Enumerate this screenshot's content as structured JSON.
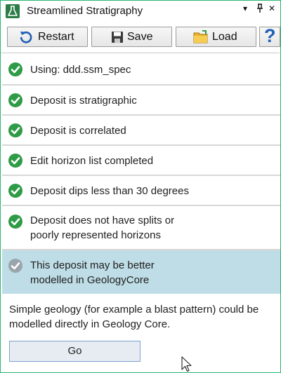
{
  "window": {
    "title": "Streamlined Stratigraphy",
    "controls": [
      "▾",
      "⊥",
      "✕"
    ],
    "border_color": "#2bb673"
  },
  "toolbar": {
    "restart_label": "Restart",
    "save_label": "Save",
    "load_label": "Load",
    "help_label": "?"
  },
  "steps": [
    {
      "text": "Using: ddd.ssm_spec",
      "status": "done"
    },
    {
      "text": "Deposit is stratigraphic",
      "status": "done"
    },
    {
      "text": "Deposit is correlated",
      "status": "done"
    },
    {
      "text": "Edit horizon list completed",
      "status": "done"
    },
    {
      "text": "Deposit dips less than 30 degrees",
      "status": "done"
    },
    {
      "text": [
        "Deposit does not have splits or",
        "poorly represented horizons"
      ],
      "status": "done"
    },
    {
      "text": [
        "This deposit may be better",
        "modelled in GeologyCore"
      ],
      "status": "current"
    }
  ],
  "info": {
    "line1": "Simple geology (for example a blast pattern) could be",
    "line2": "modelled directly in Geology Core."
  },
  "go_label": "Go",
  "colors": {
    "done_check": "#2e9b46",
    "current_check": "#9aa4ab",
    "current_row": "#bfdde6",
    "help": "#1f5fb6"
  },
  "icons": {
    "app": "flask-icon",
    "restart": "restart-icon",
    "save": "save-icon",
    "load": "folder-icon"
  }
}
